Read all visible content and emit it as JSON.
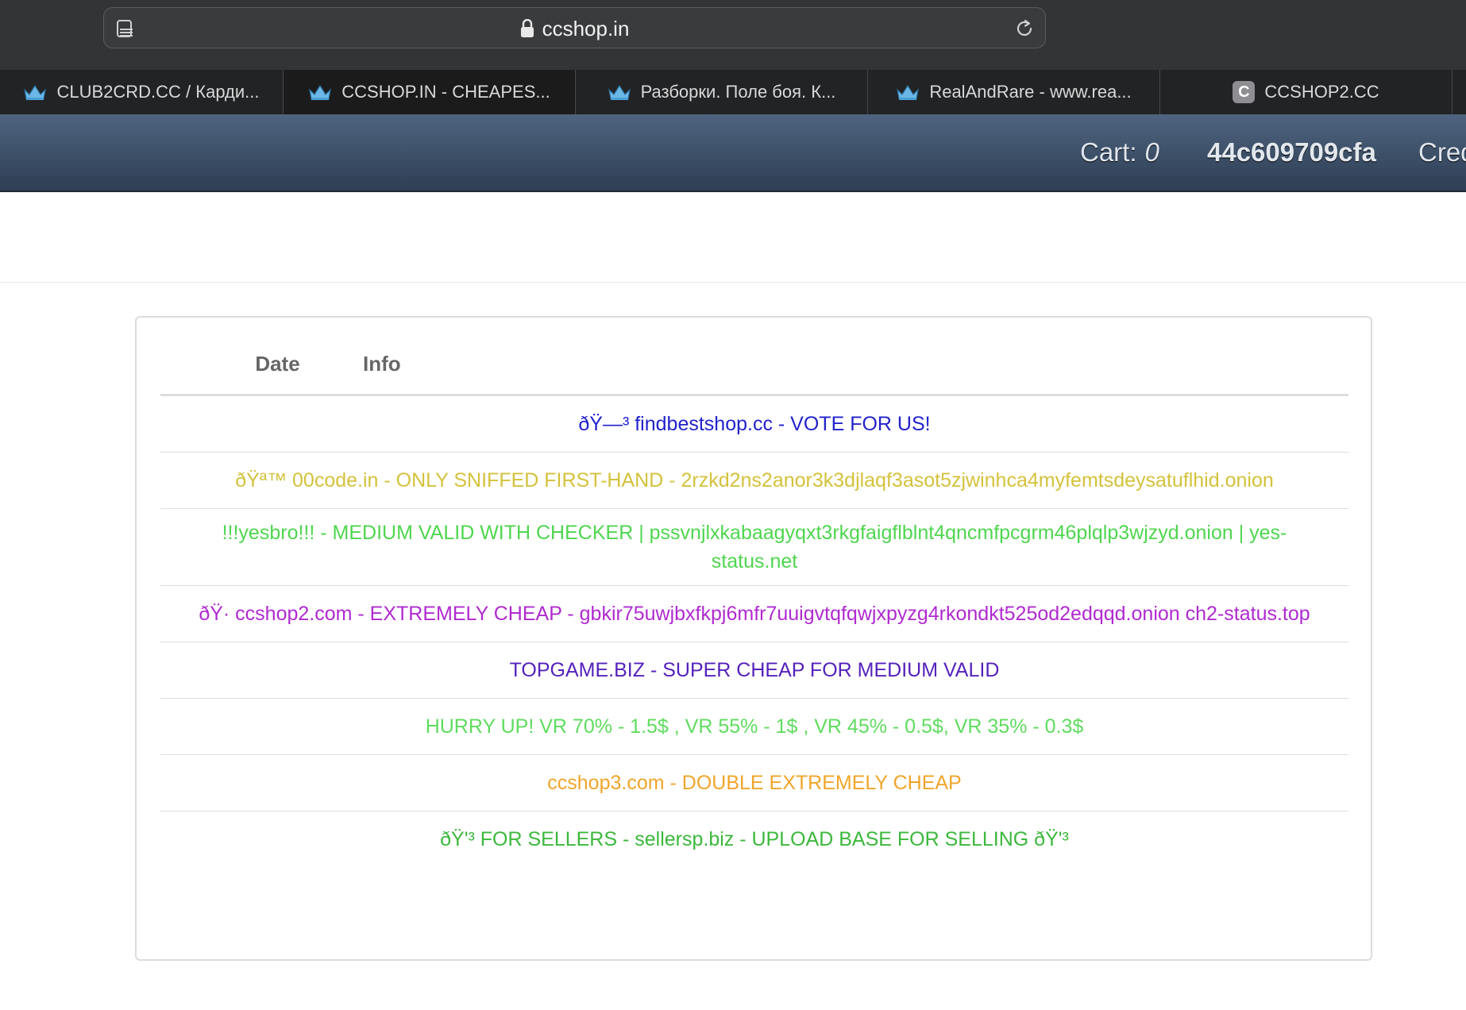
{
  "browser": {
    "url": "ccshop.in",
    "tabs": [
      {
        "label": "CLUB2CRD.CC / Карди...",
        "icon": "crown-icon"
      },
      {
        "label": "CCSHOP.IN - CHEAPES...",
        "icon": "crown-icon"
      },
      {
        "label": "Разборки. Поле боя. К...",
        "icon": "crown-icon"
      },
      {
        "label": "RealAndRare - www.rea...",
        "icon": "crown-icon"
      },
      {
        "label": "CCSHOP2.CC",
        "icon": "c-letter-icon",
        "icon_letter": "C"
      }
    ]
  },
  "header": {
    "cart_label": "Cart:",
    "cart_count": "0",
    "username": "44c609709cfa",
    "credit_label": "Cred"
  },
  "table": {
    "columns": [
      "Date",
      "Info"
    ],
    "rows": [
      {
        "date": "",
        "info": "ðŸ—³ findbestshop.cc - VOTE FOR US!",
        "color": "#2222cc"
      },
      {
        "date": "",
        "info": "ðŸª™ 00code.in - ONLY SNIFFED FIRST-HAND - 2rzkd2ns2anor3k3djlaqf3asot5zjwinhca4myfemtsdeysatuflhid.onion",
        "color": "#d4c23c"
      },
      {
        "date": "",
        "info": "!!!yesbro!!! - MEDIUM VALID WITH CHECKER | pssvnjlxkabaagyqxt3rkgfaigflblnt4qncmfpcgrm46plqlp3wjzyd.onion | yes-status.net",
        "color": "#4fd64f"
      },
      {
        "date": "",
        "info": "ðŸ· ccshop2.com - EXTREMELY CHEAP - gbkir75uwjbxfkpj6mfr7uuigvtqfqwjxpyzg4rkondkt525od2edqqd.onion ch2-status.top",
        "color": "#b02ad0"
      },
      {
        "date": "",
        "info": "TOPGAME.BIZ - SUPER CHEAP FOR MEDIUM VALID",
        "color": "#5522bb"
      },
      {
        "date": "",
        "info": "HURRY UP! VR 70% - 1.5$ , VR 55% - 1$ , VR 45% - 0.5$, VR 35% - 0.3$",
        "color": "#5fdc5f"
      },
      {
        "date": "",
        "info": "ccshop3.com - DOUBLE EXTREMELY CHEAP",
        "color": "#f0a52a"
      },
      {
        "date": "",
        "info": "ðŸ'³ FOR SELLERS - sellersp.biz - UPLOAD BASE FOR SELLING ðŸ'³",
        "color": "#3cb83c"
      }
    ]
  }
}
